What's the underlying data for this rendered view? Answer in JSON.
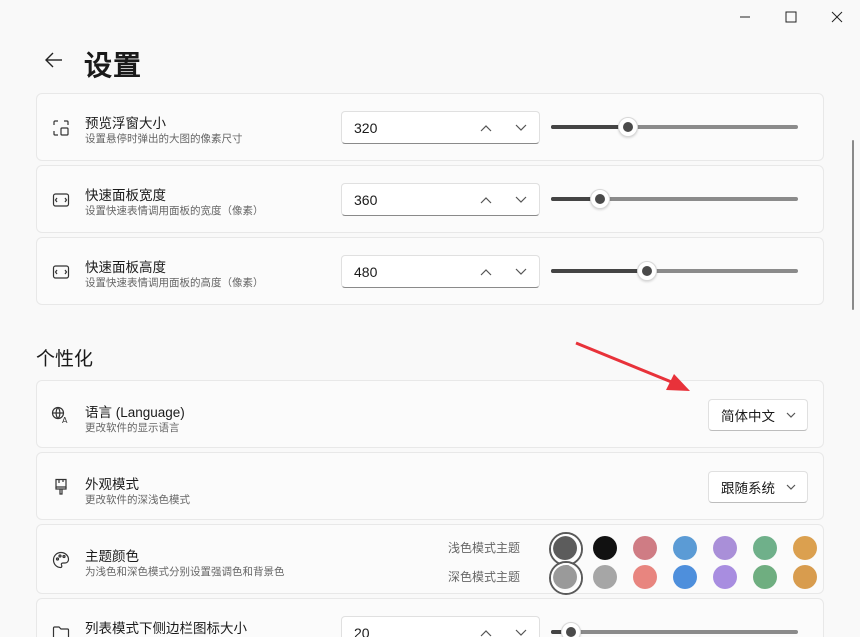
{
  "window": {
    "controls": [
      "minimize",
      "maximize",
      "close"
    ]
  },
  "header": {
    "title": "设置"
  },
  "rows": [
    {
      "title": "预览浮窗大小",
      "desc": "设置悬停时弹出的大图的像素尺寸",
      "value": "320",
      "slider_fraction": 0.31,
      "icon": "preview-window-icon"
    },
    {
      "title": "快速面板宽度",
      "desc": "设置快速表情调用面板的宽度（像素）",
      "value": "360",
      "slider_fraction": 0.2,
      "icon": "panel-width-icon"
    },
    {
      "title": "快速面板高度",
      "desc": "设置快速表情调用面板的高度（像素）",
      "value": "480",
      "slider_fraction": 0.39,
      "icon": "panel-height-icon"
    }
  ],
  "personalization": {
    "section_title": "个性化",
    "language": {
      "title": "语言 (Language)",
      "desc": "更改软件的显示语言",
      "selected": "简体中文",
      "icon": "language-icon"
    },
    "appearance": {
      "title": "外观模式",
      "desc": "更改软件的深浅色模式",
      "selected": "跟随系统",
      "icon": "brush-icon"
    },
    "theme_color": {
      "title": "主题颜色",
      "desc": "为浅色和深色模式分别设置强调色和背景色",
      "light_label": "浅色模式主题",
      "dark_label": "深色模式主题",
      "icon": "palette-icon",
      "light_colors": [
        "#5c5c5c",
        "#111111",
        "#cf7c84",
        "#5b9bd5",
        "#a98fd8",
        "#6fb08a",
        "#dba04f"
      ],
      "dark_colors": [
        "#9a9a9a",
        "#a6a6a6",
        "#e8857f",
        "#4e8fdc",
        "#a88de0",
        "#6fae80",
        "#d89c4e"
      ]
    },
    "sidebar_icon_size": {
      "title": "列表模式下侧边栏图标大小",
      "value": "20",
      "slider_fraction": 0.08,
      "icon": "folder-icon"
    }
  },
  "colors": {
    "arrow": "#e8323a"
  }
}
